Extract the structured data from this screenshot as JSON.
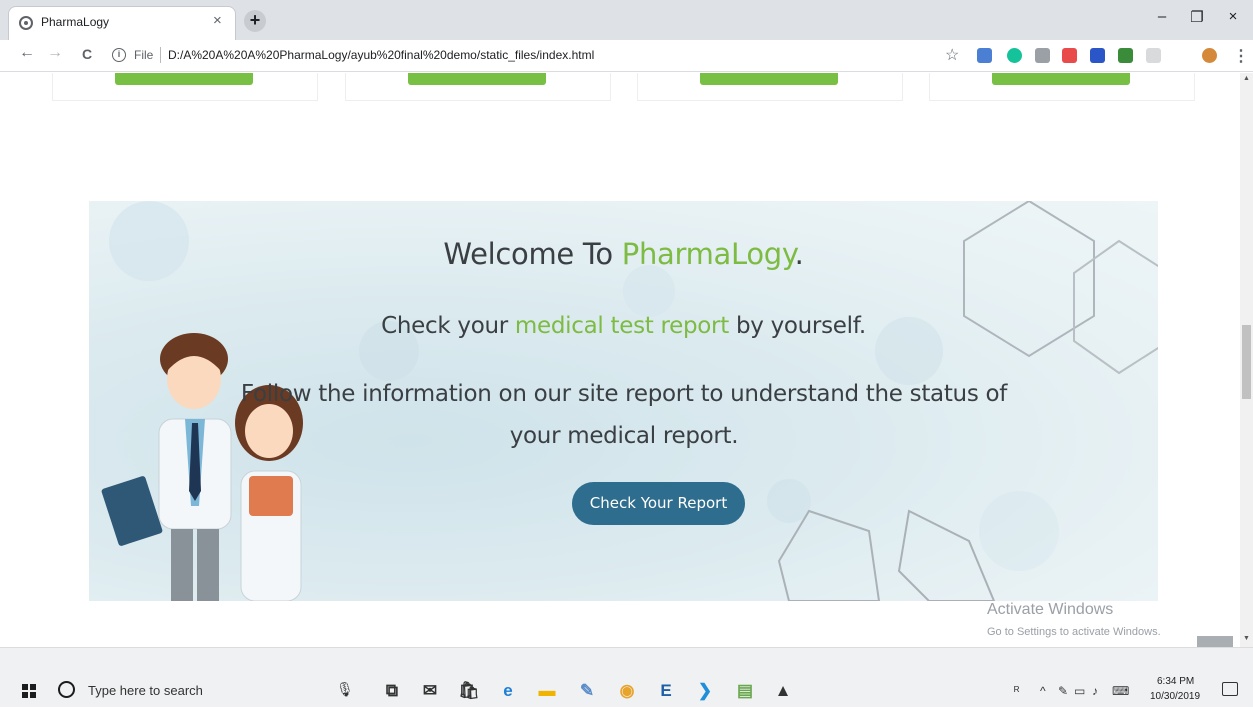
{
  "browser": {
    "tab_title": "PharmaLogy",
    "tab_close": "×",
    "new_tab": "+",
    "window_controls": {
      "minimize": "–",
      "restore": "❐",
      "close": "×"
    },
    "file_label": "File",
    "url": "D:/A%20A%20A%20PharmaLogy/ayub%20final%20demo/static_files/index.html",
    "back": "←",
    "forward": "→",
    "reload": "C",
    "star": "☆",
    "menu": "⋮",
    "extensions": [
      {
        "name": "translate-extension-icon",
        "color": "#4a7fd4"
      },
      {
        "name": "grammarly-extension-icon",
        "color": "#15c39a"
      },
      {
        "name": "pdf-extension-icon",
        "color": "#9aa0a6"
      },
      {
        "name": "flag-extension-icon",
        "color": "#e94b4b"
      },
      {
        "name": "info-extension-icon",
        "color": "#2b56c7"
      },
      {
        "name": "diamond-extension-icon",
        "color": "#3a8c3a"
      },
      {
        "name": "circle-extension-icon",
        "color": "#d8dadc"
      },
      {
        "name": "profile-avatar-icon",
        "color": "#d48a3a"
      }
    ]
  },
  "hero": {
    "welcome_prefix": "Welcome To ",
    "welcome_brand": "PharmaLogy",
    "welcome_suffix": ".",
    "line2_prefix": "Check your ",
    "line2_accent": "medical test report",
    "line2_suffix": " by yourself.",
    "line3": "Follow the information on our site report to understand the status of your medical report.",
    "button_label": "Check Your Report"
  },
  "colors": {
    "accent_green": "#7dbb42",
    "button_blue": "#2e6d8e",
    "card_button_green": "#78c043"
  },
  "watermark": {
    "title": "Activate Windows",
    "subtitle": "Go to Settings to activate Windows."
  },
  "scroll_top_glyph": "︽",
  "taskbar": {
    "search_placeholder": "Type here to search",
    "time": "6:34 PM",
    "date": "10/30/2019",
    "apps": [
      {
        "name": "task-view-icon",
        "glyph": "⧉",
        "color": "#333333"
      },
      {
        "name": "mail-icon",
        "glyph": "✉",
        "color": "#333333"
      },
      {
        "name": "store-icon",
        "glyph": "🛍",
        "color": "#333333"
      },
      {
        "name": "edge-icon",
        "glyph": "e",
        "color": "#1f7fd6"
      },
      {
        "name": "file-explorer-icon",
        "glyph": "▬",
        "color": "#f0b400"
      },
      {
        "name": "paint-icon",
        "glyph": "✎",
        "color": "#5b8dc9"
      },
      {
        "name": "chrome-icon",
        "glyph": "◉",
        "color": "#e8a32a"
      },
      {
        "name": "app-e-icon",
        "glyph": "E",
        "color": "#1f5fa8"
      },
      {
        "name": "vscode-icon",
        "glyph": "❯",
        "color": "#1e8fd8"
      },
      {
        "name": "notepad-icon",
        "glyph": "▤",
        "color": "#6aa84f"
      },
      {
        "name": "photos-icon",
        "glyph": "▲",
        "color": "#333333"
      }
    ]
  }
}
